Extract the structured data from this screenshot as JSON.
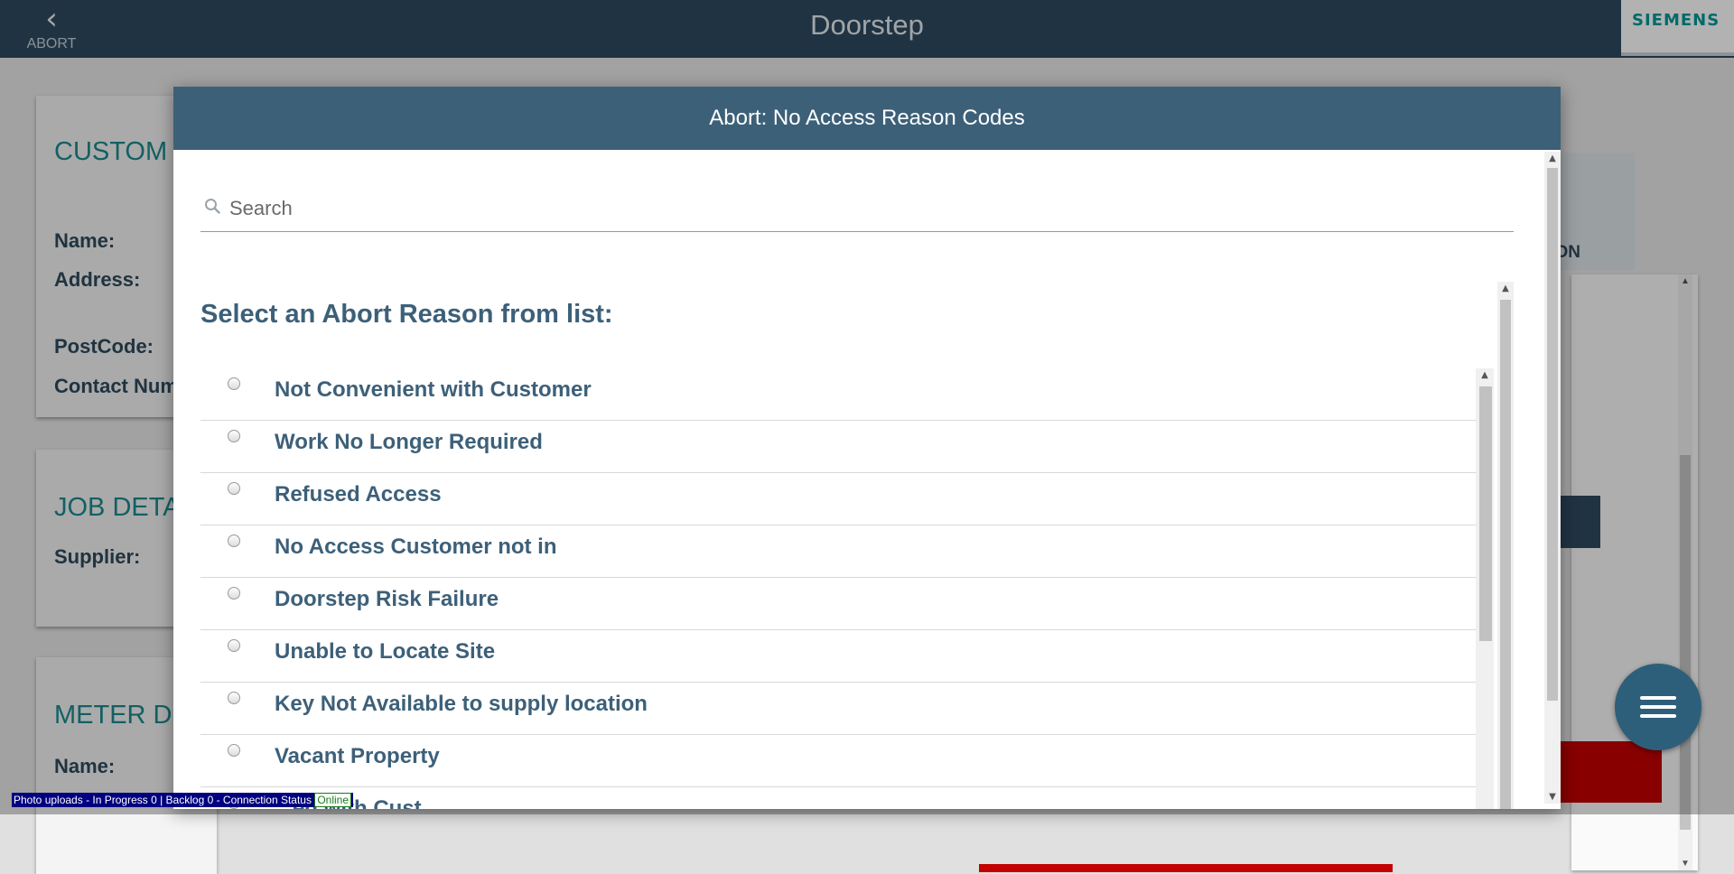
{
  "topbar": {
    "back_label": "ABORT",
    "title": "Doorstep",
    "logo_text": "SIEMENS"
  },
  "background": {
    "customer_card": {
      "title": "CUSTOM",
      "fields": [
        "Name:",
        "Address:",
        "PostCode:",
        "Contact Num"
      ]
    },
    "job_card": {
      "title": "JOB DETA",
      "fields": [
        "Supplier:"
      ]
    },
    "meter_card": {
      "title": "METER D",
      "fields": [
        "Name:"
      ]
    },
    "right_panel_text": "ON"
  },
  "modal": {
    "title": "Abort: No Access Reason Codes",
    "search": {
      "placeholder": "Search",
      "value": ""
    },
    "list_heading": "Select an Abort Reason from list:",
    "reasons": [
      "Not Convenient with Customer",
      "Work No Longer Required",
      "Refused Access",
      "No Access Customer not in",
      "Doorstep Risk Failure",
      "Unable to Locate Site",
      "Key Not Available to supply location",
      "Vacant Property",
      "...ed with Cust..."
    ]
  },
  "status_bar": {
    "text": "Photo uploads - In Progress 0 | Backlog 0 - Connection Status",
    "connection": "Online"
  },
  "colors": {
    "header_bg": "#2e4a5f",
    "modal_header_bg": "#3d6079",
    "accent_teal": "#1a8a8f",
    "danger": "#c30000"
  }
}
